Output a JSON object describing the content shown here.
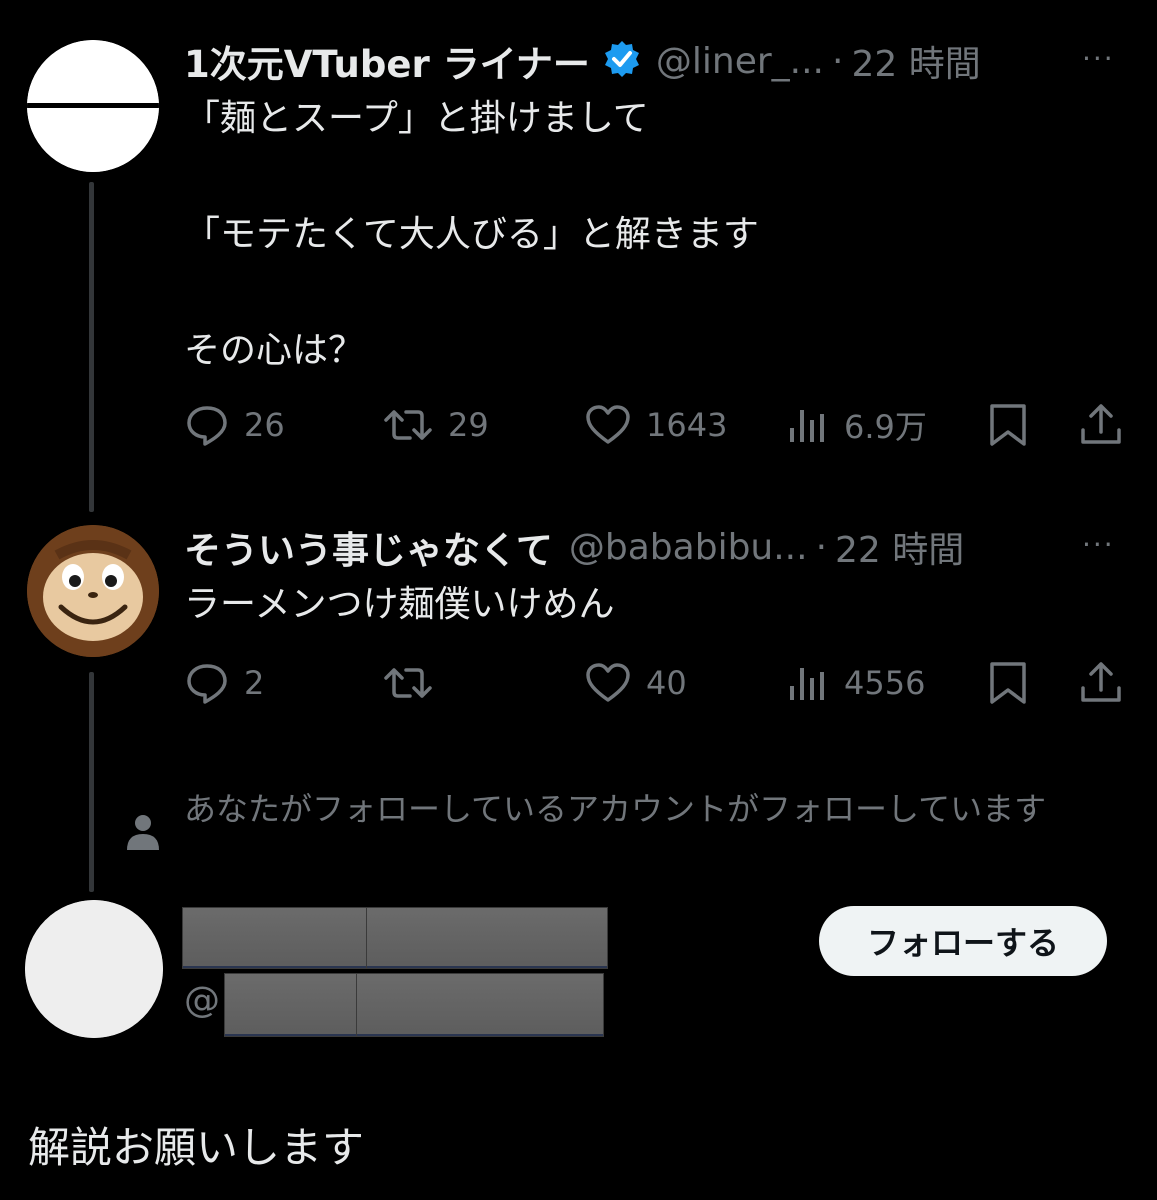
{
  "tweet1": {
    "author_name": "1次元VTuber ライナー",
    "handle": "@liner_...",
    "separator": "·",
    "time": "22 時間",
    "more": "···",
    "lines": [
      "「麺とスープ」と掛けまして",
      "",
      "「モテたくて大人びる」と解きます",
      "",
      "その心は？"
    ],
    "stats": {
      "replies": "26",
      "retweets": "29",
      "likes": "1643",
      "views": "6.9万"
    },
    "verified_color": "#1d9bf0"
  },
  "tweet2": {
    "author_name": "そういう事じゃなくて",
    "handle": "@bababibu...",
    "separator": "·",
    "time": "22 時間",
    "more": "···",
    "text": "ラーメンつけ麺僕いけめん",
    "stats": {
      "replies": "2",
      "retweets": "",
      "likes": "40",
      "views": "4556"
    }
  },
  "suggestion": {
    "context_text": "あなたがフォローしているアカウントがフォローしています",
    "handle_prefix": "@",
    "follow_label": "フォローする"
  },
  "footer": {
    "text": "解説お願いします"
  },
  "colors": {
    "background": "#000000",
    "text": "#e7e9ea",
    "muted": "#71767b",
    "accent": "#1d9bf0",
    "button_bg": "#eff3f4"
  }
}
